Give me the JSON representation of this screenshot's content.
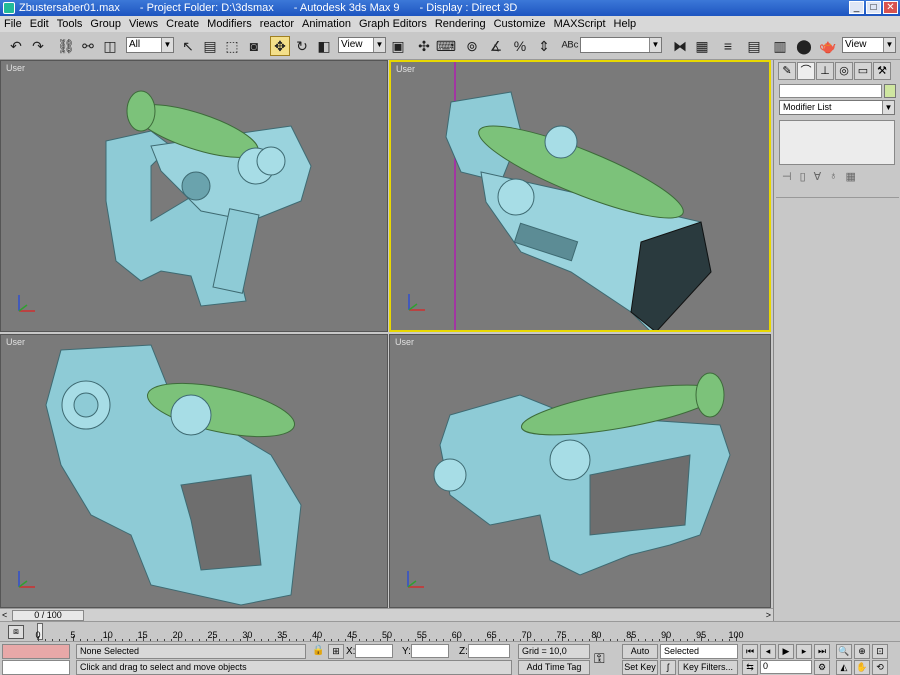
{
  "titlebar": {
    "file": "Zbustersaber01.max",
    "project": "- Project Folder: D:\\3dsmax",
    "app": "- Autodesk 3ds Max 9",
    "display": "- Display : Direct 3D"
  },
  "menu": [
    "File",
    "Edit",
    "Tools",
    "Group",
    "Views",
    "Create",
    "Modifiers",
    "reactor",
    "Animation",
    "Graph Editors",
    "Rendering",
    "Customize",
    "MAXScript",
    "Help"
  ],
  "toolbar": {
    "selection_filter": "All",
    "ref_coord_1": "View",
    "named_selection": "",
    "ref_coord_2": "View"
  },
  "viewports": [
    {
      "label": "User"
    },
    {
      "label": "User"
    },
    {
      "label": "User"
    },
    {
      "label": "User"
    }
  ],
  "command_panel": {
    "modifier_list": "Modifier List"
  },
  "time_slider": {
    "frame": "0 / 100"
  },
  "trackbar": {
    "ticks": [
      "0",
      "5",
      "10",
      "15",
      "20",
      "25",
      "30",
      "35",
      "40",
      "45",
      "50",
      "55",
      "60",
      "65",
      "70",
      "75",
      "80",
      "85",
      "90",
      "95",
      "100"
    ]
  },
  "status": {
    "selection": "None Selected",
    "prompt": "Click and drag to select and move objects",
    "x_label": "X:",
    "y_label": "Y:",
    "z_label": "Z:",
    "grid": "Grid = 10,0",
    "add_time_tag": "Add Time Tag",
    "auto_key": "Auto Key",
    "set_key": "Set Key",
    "key_mode": "Selected",
    "key_filters": "Key Filters...",
    "current_frame": "0"
  },
  "colors": {
    "active_viewport": "#e8d800",
    "mesh_blue": "#8ecbd6",
    "mesh_green": "#7cc27a"
  }
}
